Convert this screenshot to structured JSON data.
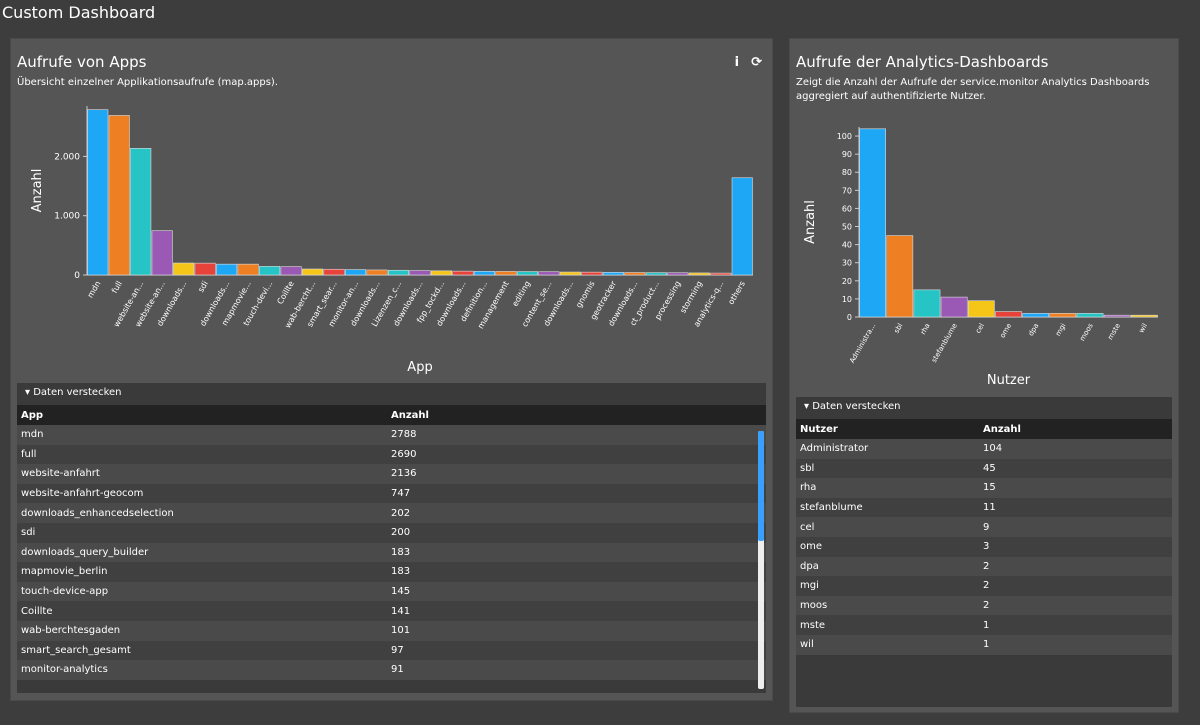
{
  "header": {
    "title": "Custom Dashboard"
  },
  "left": {
    "title": "Aufrufe von Apps",
    "subtitle": "Übersicht einzelner Applikationsaufrufe (map.apps).",
    "info_icon": "info-icon",
    "refresh_icon": "refresh-icon",
    "toggle": "Daten verstecken",
    "table": {
      "headers": [
        "App",
        "Anzahl"
      ],
      "rows": [
        [
          "mdn",
          "2788"
        ],
        [
          "full",
          "2690"
        ],
        [
          "website-anfahrt",
          "2136"
        ],
        [
          "website-anfahrt-geocom",
          "747"
        ],
        [
          "downloads_enhancedselection",
          "202"
        ],
        [
          "sdi",
          "200"
        ],
        [
          "downloads_query_builder",
          "183"
        ],
        [
          "mapmovie_berlin",
          "183"
        ],
        [
          "touch-device-app",
          "145"
        ],
        [
          "Coillte",
          "141"
        ],
        [
          "wab-berchtesgaden",
          "101"
        ],
        [
          "smart_search_gesamt",
          "97"
        ],
        [
          "monitor-analytics",
          "91"
        ]
      ]
    }
  },
  "right": {
    "title": "Aufrufe der Analytics-Dashboards",
    "subtitle": "Zeigt die Anzahl der Aufrufe der service.monitor Analytics Dashboards aggregiert auf authentifizierte Nutzer.",
    "toggle": "Daten verstecken",
    "table": {
      "headers": [
        "Nutzer",
        "Anzahl"
      ],
      "rows": [
        [
          "Administrator",
          "104"
        ],
        [
          "sbl",
          "45"
        ],
        [
          "rha",
          "15"
        ],
        [
          "stefanblume",
          "11"
        ],
        [
          "cel",
          "9"
        ],
        [
          "ome",
          "3"
        ],
        [
          "dpa",
          "2"
        ],
        [
          "mgi",
          "2"
        ],
        [
          "moos",
          "2"
        ],
        [
          "mste",
          "1"
        ],
        [
          "wil",
          "1"
        ]
      ]
    }
  },
  "colors": [
    "#1ea7f5",
    "#ee7f22",
    "#26c4c4",
    "#9b59b6",
    "#f5c518",
    "#e8433a"
  ],
  "chart_data": [
    {
      "type": "bar",
      "xlabel": "App",
      "ylabel": "Anzahl",
      "ylim": [
        0,
        2850
      ],
      "yticks": [
        0,
        1000,
        2000
      ],
      "ytick_labels": [
        "0",
        "1.000",
        "2.000"
      ],
      "grid": false,
      "categories": [
        "mdn",
        "full",
        "website-an...",
        "website-an...",
        "downloads...",
        "sdi",
        "downloads...",
        "mapmovie...",
        "touch-devi...",
        "Coillte",
        "wab-bercht...",
        "smart_sear...",
        "monitor-an...",
        "downloads...",
        "Lizenzen_c...",
        "downloads...",
        "fpp_tockd...",
        "downloads...",
        "definition...",
        "management",
        "editing",
        "content_se...",
        "downloads...",
        "gnomis",
        "geotracker",
        "downloads...",
        "ct_product...",
        "processing",
        "storming",
        "analytics-q...",
        "others"
      ],
      "values": [
        2788,
        2690,
        2136,
        747,
        202,
        200,
        183,
        183,
        145,
        141,
        101,
        97,
        91,
        85,
        80,
        75,
        70,
        65,
        62,
        60,
        58,
        55,
        50,
        48,
        45,
        42,
        40,
        38,
        35,
        32,
        1640
      ]
    },
    {
      "type": "bar",
      "xlabel": "Nutzer",
      "ylabel": "Anzahl",
      "ylim": [
        0,
        105
      ],
      "yticks": [
        0,
        10,
        20,
        30,
        40,
        50,
        60,
        70,
        80,
        90,
        100
      ],
      "grid": false,
      "categories": [
        "Administra...",
        "sbl",
        "rha",
        "stefanblume",
        "cel",
        "ome",
        "dpa",
        "mgi",
        "moos",
        "mste",
        "wil"
      ],
      "values": [
        104,
        45,
        15,
        11,
        9,
        3,
        2,
        2,
        2,
        1,
        1
      ]
    }
  ]
}
